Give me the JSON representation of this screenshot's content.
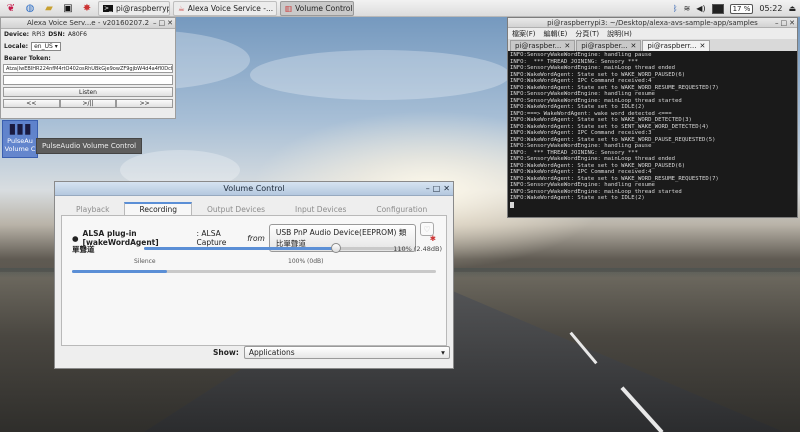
{
  "taskbar": {
    "tasks": [
      {
        "label": "pi@raspberrypi3: ~/"
      },
      {
        "label": "Alexa Voice Service -..."
      },
      {
        "label": "Volume Control"
      }
    ],
    "battery": "17 %",
    "clock": "05:22"
  },
  "alexa": {
    "title": "Alexa Voice Serv...e - v20160207.2",
    "device_label": "Device:",
    "device_value": "RPi3",
    "dsn_label": "DSN:",
    "dsn_value": "A80F6",
    "locale_label": "Locale:",
    "locale_value": "en_US",
    "bearer_label": "Bearer Token:",
    "token": "Atza|IwEBIHR224nfM4rtO402osRhUBkGje9owZF9gjbW4d4a4fl0DcKM1q-4P",
    "listen_label": "Listen",
    "prev_label": "<<",
    "play_label": ">/||",
    "next_label": ">>"
  },
  "desktop_icon": {
    "label_1": "PulseAu",
    "label_2": "Volume C",
    "tooltip": "PulseAudio Volume Control"
  },
  "terminal": {
    "title": "pi@raspberrypi3: ~/Desktop/alexa-avs-sample-app/samples",
    "menu": [
      "檔案(F)",
      "編輯(E)",
      "分頁(T)",
      "說明(H)"
    ],
    "tabs": [
      {
        "label": "pi@raspber..."
      },
      {
        "label": "pi@raspber..."
      },
      {
        "label": "pi@raspberr..."
      }
    ],
    "lines": [
      "INFO:SensoryWakeWordEngine: handling pause",
      "INFO:  *** THREAD JOINING: Sensory ***",
      "INFO:SensoryWakeWordEngine: mainLoop thread ended",
      "INFO:WakeWordAgent: State set to WAKE_WORD_PAUSED(6)",
      "INFO:WakeWordAgent: IPC Command received:4",
      "INFO:WakeWordAgent: State set to WAKE_WORD_RESUME_REQUESTED(7)",
      "INFO:SensoryWakeWordEngine: handling resume",
      "INFO:SensoryWakeWordEngine: mainLoop thread started",
      "INFO:WakeWordAgent: State set to IDLE(2)",
      "INFO:===> WakeWordAgent: wake word detected <===",
      "INFO:WakeWordAgent: State set to WAKE_WORD_DETECTED(3)",
      "INFO:WakeWordAgent: State set to SENT_WAKE_WORD_DETECTED(4)",
      "INFO:WakeWordAgent: IPC Command received:3",
      "INFO:WakeWordAgent: State set to WAKE_WORD_PAUSE_REQUESTED(5)",
      "INFO:SensoryWakeWordEngine: handling pause",
      "INFO:  *** THREAD JOINING: Sensory ***",
      "INFO:SensoryWakeWordEngine: mainLoop thread ended",
      "INFO:WakeWordAgent: State set to WAKE_WORD_PAUSED(6)",
      "INFO:WakeWordAgent: IPC Command received:4",
      "INFO:WakeWordAgent: State set to WAKE_WORD_RESUME_REQUESTED(7)",
      "INFO:SensoryWakeWordEngine: handling resume",
      "INFO:SensoryWakeWordEngine: mainLoop thread started",
      "INFO:WakeWordAgent: State set to IDLE(2)"
    ]
  },
  "volume": {
    "title": "Volume Control",
    "tabs": [
      {
        "label": "Playback"
      },
      {
        "label": "Recording"
      },
      {
        "label": "Output Devices"
      },
      {
        "label": "Input Devices"
      },
      {
        "label": "Configuration"
      }
    ],
    "active_tab": 1,
    "app_name": "ALSA plug-in [wakeWordAgent]",
    "app_desc": ": ALSA Capture",
    "from_label": "from",
    "device_button": "USB PnP Audio Device(EEPROM) 類比單聲道",
    "channel_label": "單聲道",
    "volume_pct_text": "110% (2.48dB)",
    "volume_fraction": 0.733,
    "silence_label": "Silence",
    "hundred_label": "100% (0dB)",
    "meter_fraction": 0.26,
    "show_label": "Show:",
    "show_value": "Applications"
  }
}
